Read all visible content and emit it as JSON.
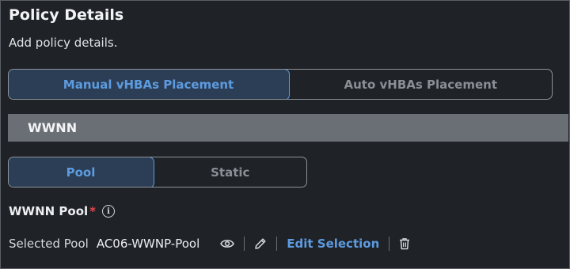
{
  "header": {
    "title": "Policy Details",
    "subtitle": "Add policy details."
  },
  "placement_toggle": {
    "options": [
      "Manual vHBAs Placement",
      "Auto vHBAs Placement"
    ],
    "selected": "Manual vHBAs Placement"
  },
  "section": {
    "title": "WWNN"
  },
  "pool_toggle": {
    "options": [
      "Pool",
      "Static"
    ],
    "selected": "Pool"
  },
  "wwnn_pool": {
    "label": "WWNN Pool",
    "required_mark": "*",
    "info_icon": "info-icon",
    "selected_label": "Selected Pool",
    "selected_value": "AC06-WWNP-Pool",
    "edit_label": "Edit Selection",
    "icons": [
      "eye-icon",
      "pencil-icon",
      "trash-icon"
    ]
  },
  "colors": {
    "accent": "#5d9be0",
    "background": "#1f2227",
    "section_bar": "#6a6f75",
    "required": "#e5484d"
  }
}
